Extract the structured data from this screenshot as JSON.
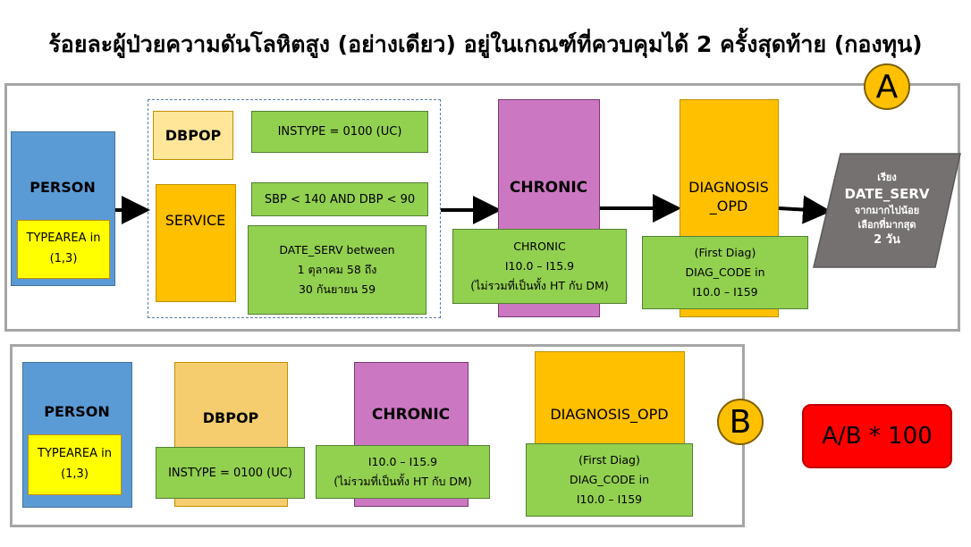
{
  "title": "ร้อยละผู้ป่วยความดันโลหิตสูง (อย่างเดียว) อยู่ในเกณฑ์ที่ควบคุมได้ 2 ครั้งสุดท้าย (กองทุน)",
  "section_a": {
    "badge": "A",
    "person": {
      "label": "PERSON",
      "condition_1": "TYPEAREA in",
      "condition_2": "(1,3)"
    },
    "dbpop": {
      "label": "DBPOP",
      "condition": "INSTYPE = 0100 (UC)"
    },
    "service": {
      "label": "SERVICE",
      "condition_bp": "SBP < 140 AND DBP < 90",
      "date_1": "DATE_SERV between",
      "date_2": "1 ตุลาคม 58 ถึง",
      "date_3": "30 กันยายน 59"
    },
    "chronic": {
      "label": "CHRONIC",
      "cond_1": "CHRONIC",
      "cond_2": "I10.0 – I15.9",
      "cond_3": "(ไม่รวมที่เป็นทั้ง HT กับ DM)"
    },
    "diagnosis": {
      "label_1": "DIAGNOSIS",
      "label_2": "_OPD",
      "cond_1": "(First Diag)",
      "cond_2": "DIAG_CODE in",
      "cond_3": "I10.0 – I159"
    },
    "sort": {
      "line_1": "เรียง",
      "line_2": "DATE_SERV",
      "line_3": "จากมากไปน้อย",
      "line_4": "เลือกที่มากสุด",
      "line_5": "2 วัน"
    }
  },
  "section_b": {
    "badge": "B",
    "person": {
      "label": "PERSON",
      "condition_1": "TYPEAREA in",
      "condition_2": "(1,3)"
    },
    "dbpop": {
      "label": "DBPOP",
      "condition": "INSTYPE = 0100 (UC)"
    },
    "chronic": {
      "label": "CHRONIC",
      "cond_1": "I10.0 – I15.9",
      "cond_2": "(ไม่รวมที่เป็นทั้ง HT กับ DM)"
    },
    "diagnosis": {
      "label": "DIAGNOSIS_OPD",
      "cond_1": "(First Diag)",
      "cond_2": "DIAG_CODE in",
      "cond_3": "I10.0 – I159"
    }
  },
  "formula": "A/B * 100",
  "colors": {
    "person": "#5b9bd5",
    "condition": "#92d050",
    "chronic": "#cc77c1",
    "service": "#ffc000",
    "dbpop": "#ffe699",
    "highlight": "#ffff00",
    "result": "#ff0000",
    "sort": "#767171"
  }
}
